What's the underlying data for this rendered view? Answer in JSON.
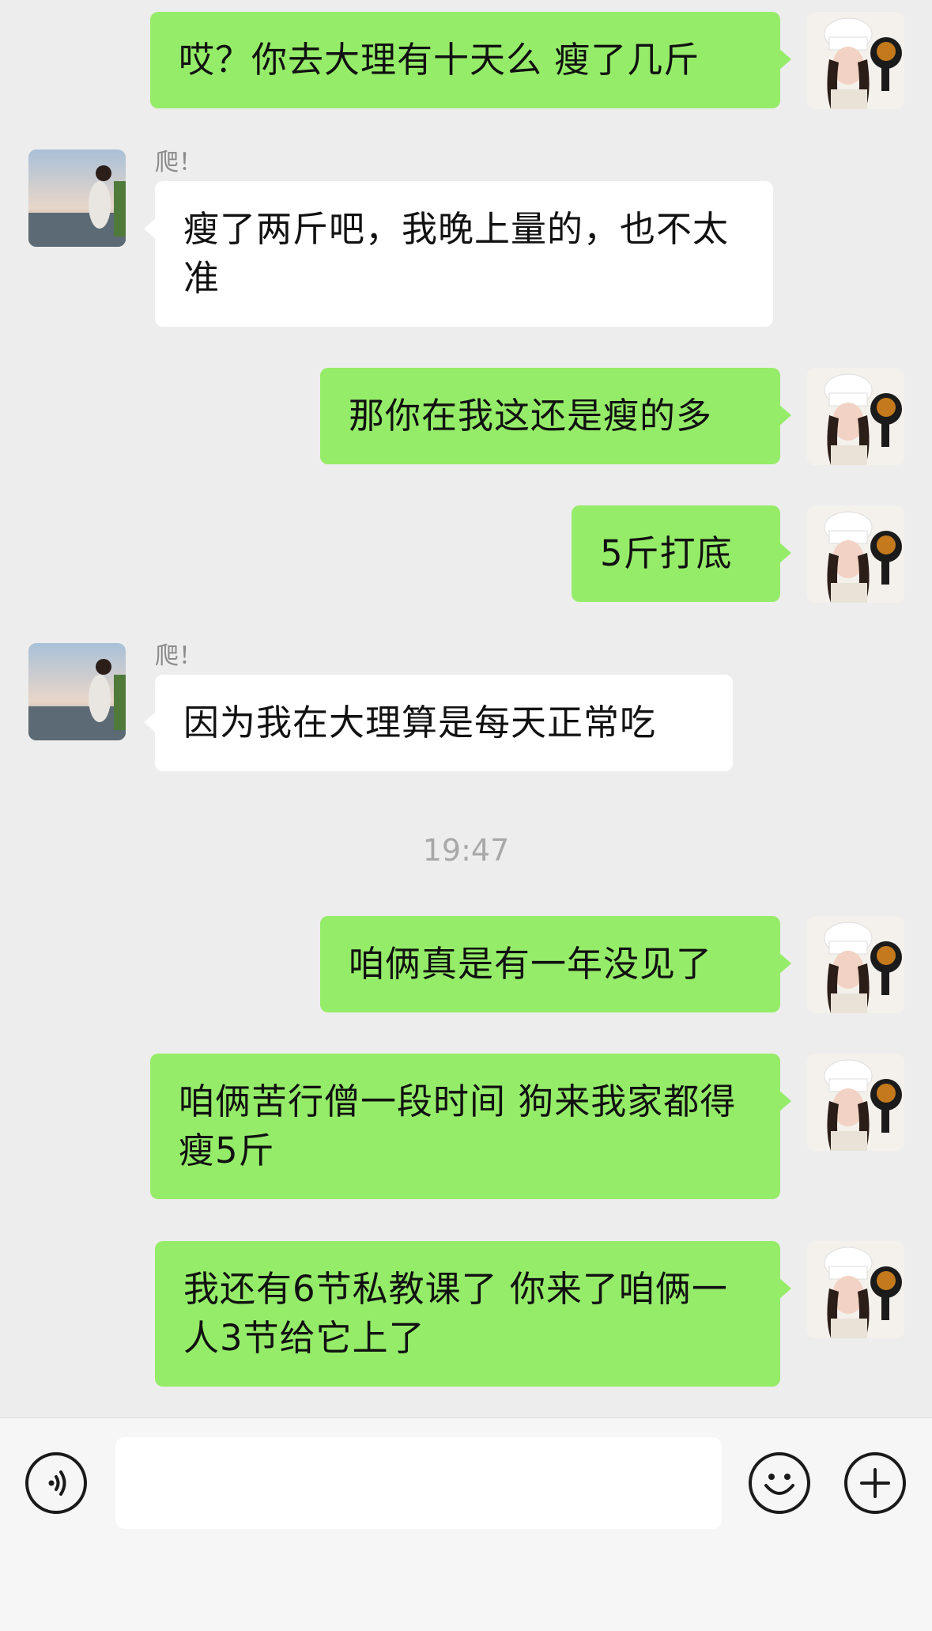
{
  "messages": [
    {
      "side": "me",
      "text": "哎？你去大理有十天么 瘦了几斤"
    },
    {
      "side": "other",
      "sender": "爬！",
      "text": "瘦了两斤吧，我晚上量的，也不太准"
    },
    {
      "side": "me",
      "text": "那你在我这还是瘦的多"
    },
    {
      "side": "me",
      "text": "5斤打底"
    },
    {
      "side": "other",
      "sender": "爬！",
      "text": "因为我在大理算是每天正常吃"
    },
    {
      "side": "me",
      "text": "咱俩真是有一年没见了"
    },
    {
      "side": "me",
      "text": "咱俩苦行僧一段时间 狗来我家都得瘦5斤"
    },
    {
      "side": "me",
      "text": "我还有6节私教课了 你来了咱俩一人3节给它上了"
    }
  ],
  "timestamp": "19:47",
  "input": {
    "placeholder": ""
  },
  "icons": {
    "voice": "voice-icon",
    "emoji": "emoji-icon",
    "plus": "plus-icon"
  },
  "colors": {
    "background": "#ededed",
    "my_bubble": "#95ec69",
    "their_bubble": "#ffffff",
    "input_bar": "#f6f6f6"
  }
}
